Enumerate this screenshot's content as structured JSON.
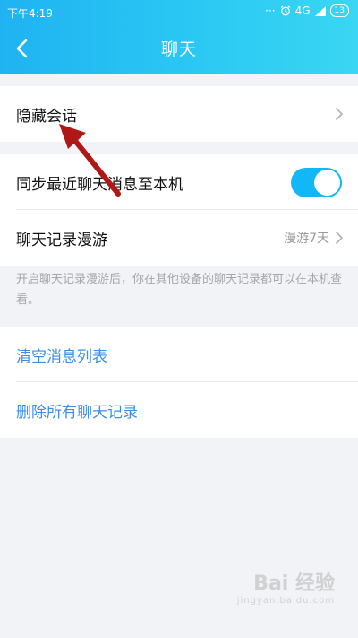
{
  "status_bar": {
    "time": "下午4:19",
    "dots": "···",
    "alarm_icon": "alarm-clock-icon",
    "network": "4G",
    "battery": "13"
  },
  "nav": {
    "title": "聊天",
    "back_icon": "chevron-left-icon"
  },
  "rows": {
    "hidden_sessions": {
      "label": "隐藏会话"
    },
    "sync_messages": {
      "label": "同步最近聊天消息至本机",
      "enabled": true
    },
    "roaming": {
      "label": "聊天记录漫游",
      "value": "漫游7天"
    }
  },
  "hint": "开启聊天记录漫游后，你在其他设备的聊天记录都可以在本机查看。",
  "actions": {
    "clear_list": "清空消息列表",
    "delete_all": "删除所有聊天记录"
  },
  "watermark": {
    "text": "Bai 经验",
    "sub": "jingyan.baidu.com"
  },
  "colors": {
    "header_start": "#1fb3f2",
    "header_end": "#3ad6f3",
    "toggle_on": "#12b7f5",
    "action_text": "#3a8ee6",
    "annotation_arrow": "#b01818"
  }
}
